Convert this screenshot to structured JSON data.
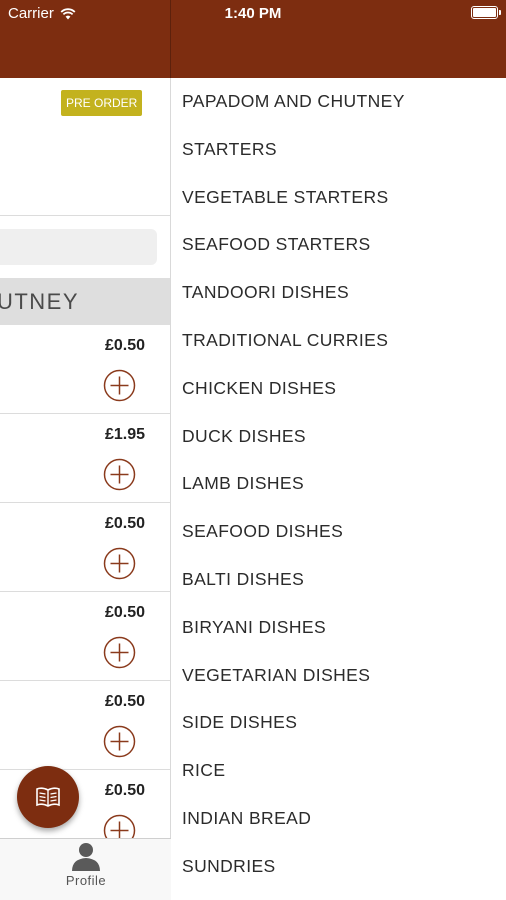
{
  "status_bar": {
    "carrier": "Carrier",
    "time": "1:40 PM"
  },
  "colors": {
    "brand": "#7d2d10",
    "preorder_badge": "#c3b21e",
    "category_header_bg": "#dedede"
  },
  "left_panel": {
    "preorder_label": "PRE ORDER",
    "category_header": "UTNEY",
    "items": [
      {
        "price": "£0.50"
      },
      {
        "price": "£1.95"
      },
      {
        "price": "£0.50"
      },
      {
        "price": "£0.50"
      },
      {
        "price": "£0.50"
      },
      {
        "price": "£0.50"
      }
    ],
    "fab_icon": "menu-book-icon",
    "tabbar": {
      "profile_label": "Profile",
      "profile_icon": "person-icon"
    }
  },
  "categories": [
    "PAPADOM AND CHUTNEY",
    "STARTERS",
    "VEGETABLE STARTERS",
    "SEAFOOD STARTERS",
    "TANDOORI DISHES",
    "TRADITIONAL CURRIES",
    "CHICKEN DISHES",
    "DUCK DISHES",
    "LAMB DISHES",
    "SEAFOOD DISHES",
    "BALTI DISHES",
    "BIRYANI DISHES",
    "VEGETARIAN DISHES",
    "SIDE DISHES",
    "RICE",
    "INDIAN BREAD",
    "SUNDRIES"
  ]
}
